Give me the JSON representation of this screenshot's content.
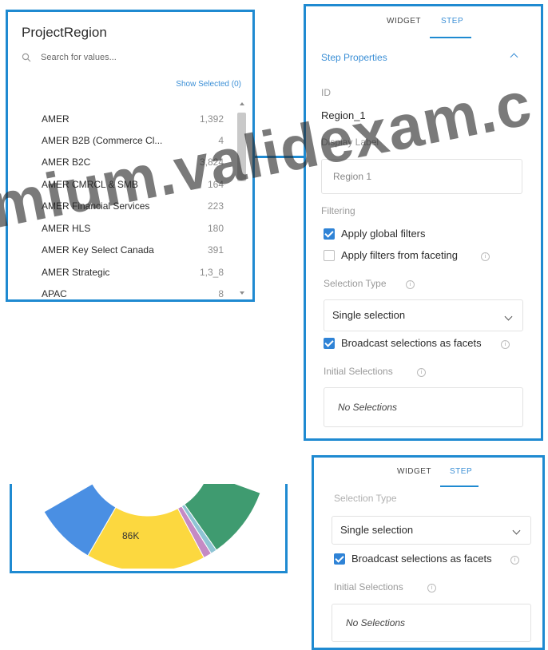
{
  "list_widget": {
    "title": "ProjectRegion",
    "search_placeholder": "Search for values...",
    "show_selected": "Show Selected (0)",
    "items": [
      {
        "name": "AMER",
        "count": "1,392"
      },
      {
        "name": "AMER B2B (Commerce Cl...",
        "count": "4"
      },
      {
        "name": "AMER B2C",
        "count": "3,824"
      },
      {
        "name": "AMER CMRCL & SMB",
        "count": "164"
      },
      {
        "name": "AMER Financial Services",
        "count": "223"
      },
      {
        "name": "AMER HLS",
        "count": "180"
      },
      {
        "name": "AMER Key Select Canada",
        "count": "391"
      },
      {
        "name": "AMER Strategic",
        "count": "1,3_8"
      },
      {
        "name": "APAC",
        "count": "8"
      }
    ]
  },
  "step_panel": {
    "tabs": [
      "WIDGET",
      "STEP"
    ],
    "active_tab": "STEP",
    "section_title": "Step Properties",
    "id_label": "ID",
    "id_value": "Region_1",
    "display_label_label": "Display Label",
    "display_label_value": "Region 1",
    "filtering_label": "Filtering",
    "apply_global_filters": {
      "label": "Apply global filters",
      "checked": true
    },
    "apply_faceting_filters": {
      "label": "Apply filters from faceting",
      "checked": false
    },
    "selection_type_label": "Selection Type",
    "selection_type_value": "Single selection",
    "broadcast": {
      "label": "Broadcast selections as facets",
      "checked": true
    },
    "initial_selections_label": "Initial Selections",
    "no_selections": "No Selections"
  },
  "chart_data": {
    "type": "pie",
    "segment_label": "86K",
    "colors": [
      "#4a8fe3",
      "#fcd83f",
      "#c58ac4",
      "#8fc4d4",
      "#3f9b70"
    ]
  },
  "step_panel_2": {
    "tabs": [
      "WIDGET",
      "STEP"
    ],
    "active_tab": "STEP",
    "selection_type_label": "Selection Type",
    "selection_type_value": "Single selection",
    "broadcast": {
      "label": "Broadcast selections as facets",
      "checked": true
    },
    "initial_selections_label": "Initial Selections",
    "no_selections": "No Selections"
  },
  "watermark": "mium.validexam.c"
}
